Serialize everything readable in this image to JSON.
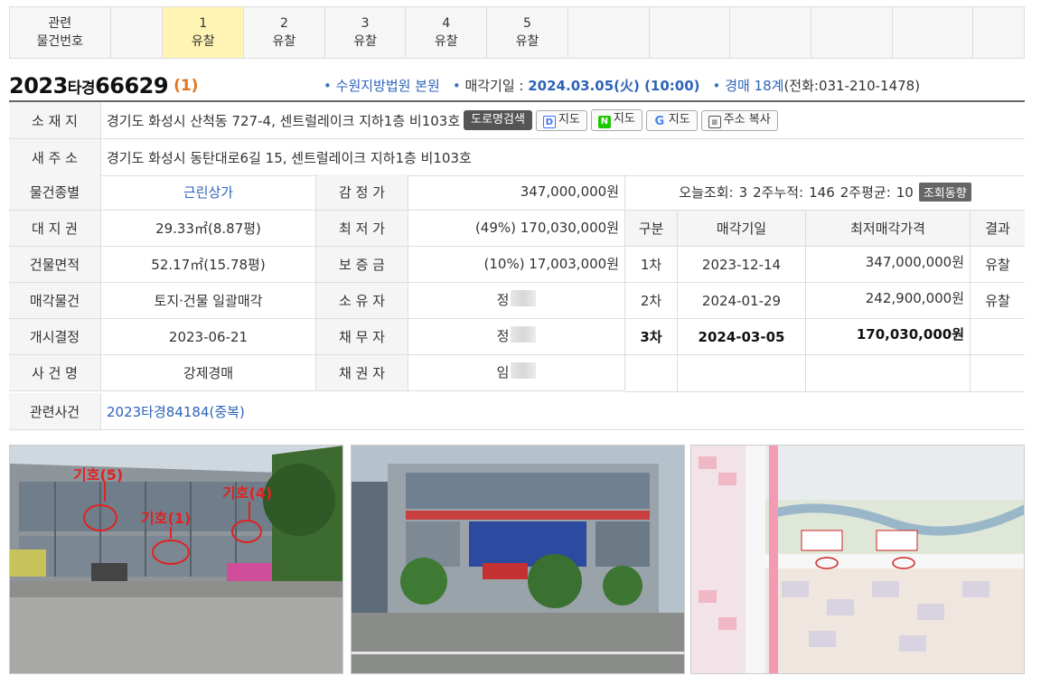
{
  "related": {
    "label_line1": "관련",
    "label_line2": "물건번호",
    "items": [
      {
        "num": "1",
        "status": "유찰"
      },
      {
        "num": "2",
        "status": "유찰"
      },
      {
        "num": "3",
        "status": "유찰"
      },
      {
        "num": "4",
        "status": "유찰"
      },
      {
        "num": "5",
        "status": "유찰"
      }
    ]
  },
  "case": {
    "year": "2023",
    "type": "타경",
    "number": "66629",
    "seq": "(1)",
    "court": "수원지방법원 본원",
    "date_label": "매각기일 : ",
    "date_value": "2024.03.05(火) (10:00)",
    "dept": "경매 18계",
    "phone": "(전화:031-210-1478)"
  },
  "address": {
    "label": "소 재 지",
    "value": "경기도 화성시 산척동 727-4, 센트럴레이크 지하1층 비103호",
    "btn_road": "도로명검색",
    "btn_daum": "지도",
    "btn_naver": "지도",
    "btn_google": "지도",
    "btn_copy": "주소 복사"
  },
  "new_address": {
    "label": "새 주 소",
    "value": "경기도 화성시 동탄대로6길 15, 센트럴레이크 지하1층 비103호"
  },
  "details": {
    "rows": [
      {
        "l1": "물건종별",
        "v1": "근린상가",
        "l2": "감 정 가",
        "v2": "347,000,000원"
      },
      {
        "l1": "대 지 권",
        "v1": "29.33㎡(8.87평)",
        "l2": "최 저 가",
        "v2": "(49%) 170,030,000원"
      },
      {
        "l1": "건물면적",
        "v1": "52.17㎡(15.78평)",
        "l2": "보 증 금",
        "v2": "(10%) 17,003,000원"
      },
      {
        "l1": "매각물건",
        "v1": "토지·건물 일괄매각",
        "l2": "소 유 자",
        "v2": "정"
      },
      {
        "l1": "개시결정",
        "v1": "2023-06-21",
        "l2": "채 무 자",
        "v2": "정"
      },
      {
        "l1": "사 건 명",
        "v1": "강제경매",
        "l2": "채 권 자",
        "v2": "임"
      }
    ]
  },
  "stats": {
    "today_label": "오늘조회:",
    "today": "3",
    "two_week_label": "2주누적:",
    "two_week": "146",
    "avg_label": "2주평균:",
    "avg": "10",
    "trend_btn": "조회동향"
  },
  "history": {
    "headers": [
      "구분",
      "매각기일",
      "최저매각가격",
      "결과"
    ],
    "rows": [
      {
        "round": "1차",
        "date": "2023-12-14",
        "price": "347,000,000원",
        "result": "유찰"
      },
      {
        "round": "2차",
        "date": "2024-01-29",
        "price": "242,900,000원",
        "result": "유찰"
      },
      {
        "round": "3차",
        "date": "2024-03-05",
        "price": "170,030,000원",
        "result": ""
      }
    ]
  },
  "related_case": {
    "label": "관련사건",
    "value": "2023타경84184(중복)"
  }
}
